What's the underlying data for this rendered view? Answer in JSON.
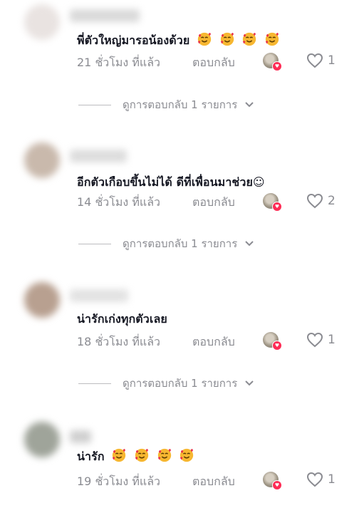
{
  "comments": [
    {
      "text": "พี่ตัวใหญ่มารอน้องด้วย",
      "emoji_count": 4,
      "time": "21 ชั่วโมง ที่แล้ว",
      "reply_label": "ตอบกลับ",
      "likes": "1",
      "view_replies": "ดูการตอบกลับ 1 รายการ"
    },
    {
      "text": "อีกตัวเกือบขึ้นไม่ได้ ดีที่เพื่อนมาช่วย☺",
      "emoji_count": 0,
      "time": "14 ชั่วโมง ที่แล้ว",
      "reply_label": "ตอบกลับ",
      "likes": "2",
      "view_replies": "ดูการตอบกลับ 1 รายการ"
    },
    {
      "text": "น่ารักเก่งทุกตัวเลย",
      "emoji_count": 0,
      "time": "18 ชั่วโมง ที่แล้ว",
      "reply_label": "ตอบกลับ",
      "likes": "1",
      "view_replies": "ดูการตอบกลับ 1 รายการ"
    },
    {
      "text": "น่ารัก",
      "emoji_count": 4,
      "time": "19 ชั่วโมง ที่แล้ว",
      "reply_label": "ตอบกลับ",
      "likes": "1"
    }
  ],
  "colors": {
    "text": "#161823",
    "muted": "#8a8b91",
    "creator_badge": "#fe2c55"
  },
  "icons": {
    "emoji": "smiling-face-with-hearts-icon",
    "like": "heart-outline-icon",
    "expand": "chevron-down-icon"
  }
}
